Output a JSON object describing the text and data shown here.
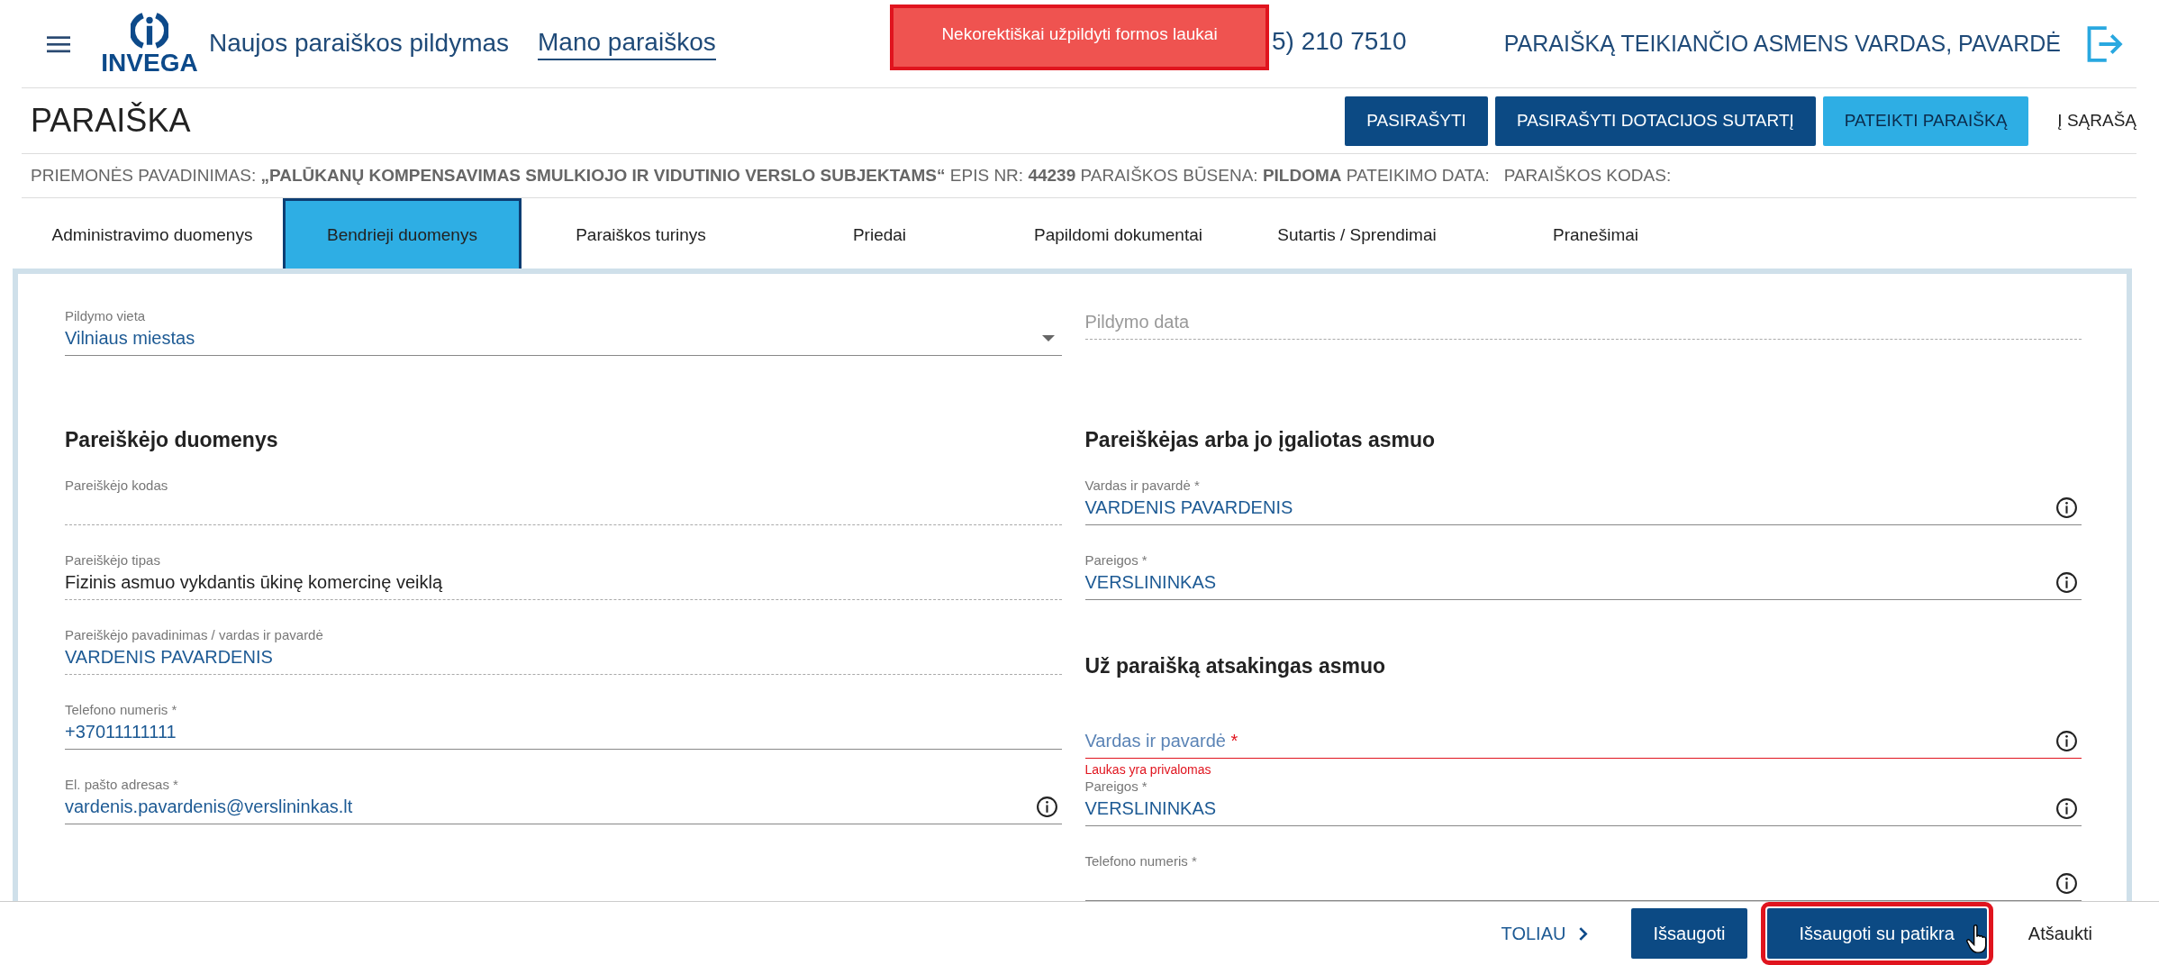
{
  "header": {
    "logo_text": "INVEGA",
    "nav": [
      {
        "label": "Naujos paraiškos pildymas",
        "selected": false
      },
      {
        "label": "Mano paraiškos",
        "selected": true
      }
    ],
    "toast": {
      "text": "Nekorektiškai užpildyti formos laukai",
      "highlighted": true
    },
    "phone": "5) 210 7510",
    "user": "PARAIŠKĄ TEIKIANČIO ASMENS VARDAS, PAVARDĖ"
  },
  "page_title": "PARAIŠKA",
  "actions": [
    {
      "label": "PASIRAŠYTI",
      "kind": "dark"
    },
    {
      "label": "PASIRAŠYTI DOTACIJOS SUTARTĮ",
      "kind": "dark"
    },
    {
      "label": "PATEIKTI PARAIŠKĄ",
      "kind": "light"
    },
    {
      "label": "Į SĄRAŠĄ",
      "kind": "link"
    }
  ],
  "meta": "PRIEMONĖS PAVADINIMAS: **„PALŪKANŲ KOMPENSAVIMAS SMULKIOJO IR VIDUTINIO VERSLO SUBJEKTAMS“** EPIS NR: **44239** PARAIŠKOS BŪSENA: **PILDOMA** PATEIKIMO DATA:   PARAIŠKOS KODAS:",
  "tabs": [
    {
      "label": "Administravimo duomenys",
      "selected": false
    },
    {
      "label": "Bendrieji duomenys",
      "selected": true
    },
    {
      "label": "Paraiškos turinys",
      "selected": false
    },
    {
      "label": "Priedai",
      "selected": false
    },
    {
      "label": "Papildomi dokumentai",
      "selected": false
    },
    {
      "label": "Sutartis / Sprendimai",
      "selected": false
    },
    {
      "label": "Pranešimai",
      "selected": false
    }
  ],
  "form": {
    "top": [
      {
        "kind": "select",
        "label": "Pildymo vieta",
        "value": "Vilniaus miestas"
      },
      {
        "kind": "readonly",
        "placeholder": "Pildymo data"
      }
    ],
    "left": [
      {
        "heading": "Pareiškėjo duomenys",
        "fields": [
          {
            "kind": "readonly",
            "label": "Pareiškėjo kodas"
          },
          {
            "kind": "readonly",
            "label": "Pareiškėjo tipas",
            "value": "Fizinis asmuo vykdantis ūkinę komercinę veiklą"
          },
          {
            "kind": "prefilled",
            "label": "Pareiškėjo pavadinimas / vardas ir pavardė",
            "value": "VARDENIS PAVARDENIS"
          },
          {
            "kind": "text",
            "label": "Telefono numeris *",
            "value": "+37011111111"
          },
          {
            "kind": "text",
            "label": "El. pašto adresas *",
            "value": "vardenis.pavardenis@verslininkas.lt",
            "info": true
          }
        ]
      }
    ],
    "right": [
      {
        "heading": "Pareiškėjas arba jo įgaliotas asmuo",
        "fields": [
          {
            "kind": "text",
            "label": "Vardas ir pavardė *",
            "value": "VARDENIS PAVARDENIS",
            "info": true
          },
          {
            "kind": "text",
            "label": "Pareigos *",
            "value": "VERSLININKAS",
            "info": true
          }
        ]
      },
      {
        "heading": "Už paraišką atsakingas asmuo",
        "fields": [
          {
            "kind": "text",
            "placeholder": "Vardas ir pavardė",
            "required_mark": "*",
            "info": true,
            "error": "Laukas yra privalomas"
          },
          {
            "kind": "text",
            "label": "Pareigos *",
            "value": "VERSLININKAS",
            "info": true
          },
          {
            "kind": "text",
            "label": "Telefono numeris *",
            "info": true
          }
        ]
      }
    ]
  },
  "footer": [
    {
      "label": "TOLIAU",
      "kind": "next",
      "highlighted": false
    },
    {
      "label": "Išsaugoti",
      "kind": "primary",
      "highlighted": false
    },
    {
      "label": "Išsaugoti su patikra",
      "kind": "primary",
      "highlighted": true
    },
    {
      "label": "Atšaukti",
      "kind": "link",
      "highlighted": false
    }
  ]
}
